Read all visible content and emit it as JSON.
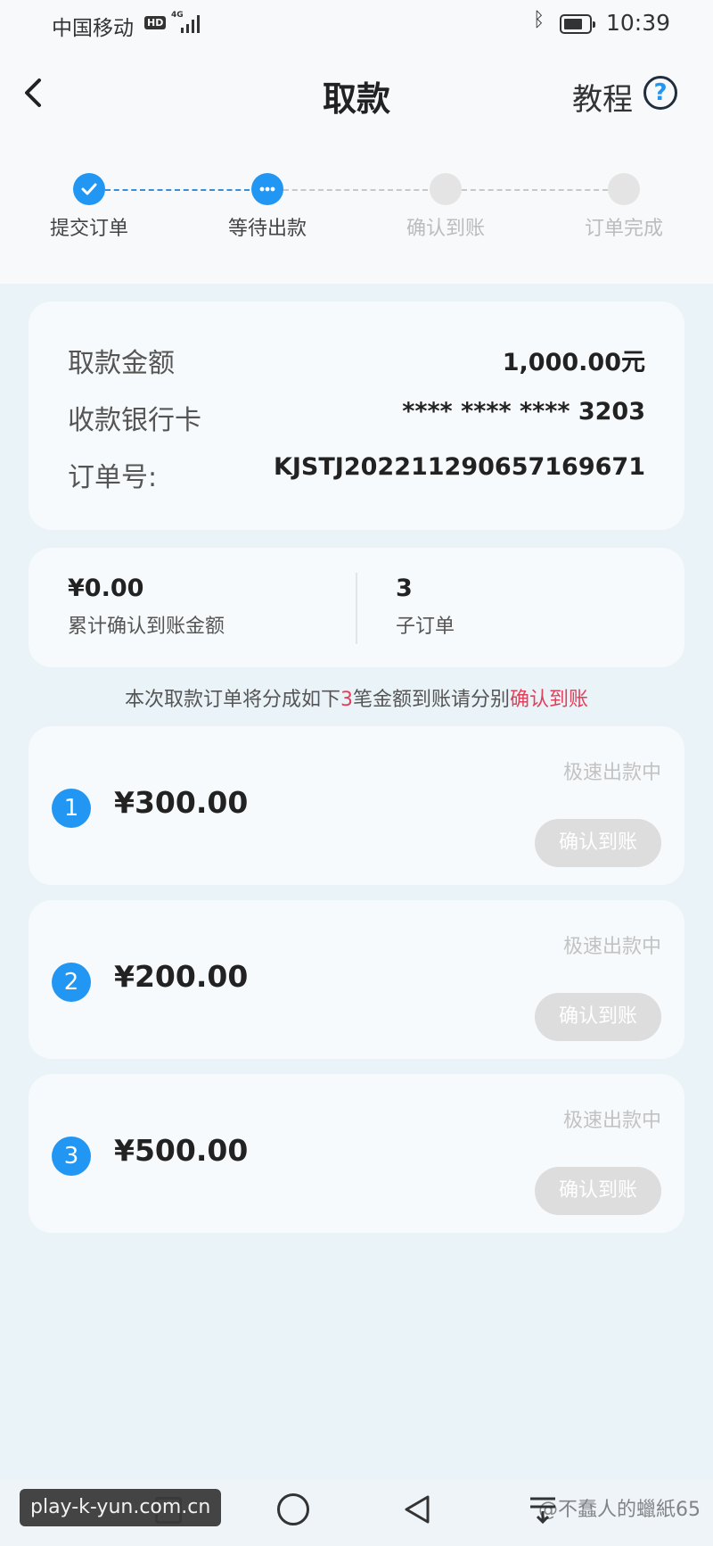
{
  "status_bar": {
    "carrier": "中国移动",
    "hd": "HD",
    "network": "4G",
    "time": "10:39"
  },
  "header": {
    "title": "取款",
    "tutorial_label": "教程",
    "help_icon": "?"
  },
  "stepper": {
    "steps": [
      {
        "label": "提交订单",
        "state": "done"
      },
      {
        "label": "等待出款",
        "state": "current"
      },
      {
        "label": "确认到账",
        "state": "pending"
      },
      {
        "label": "订单完成",
        "state": "pending"
      }
    ]
  },
  "info": {
    "amount_label": "取款金额",
    "amount_value": "1,000.00元",
    "card_label": "收款银行卡",
    "card_value": "**** **** **** 3203",
    "order_label": "订单号:",
    "order_value": "KJSTJ20221129065716967‌1"
  },
  "summary": {
    "confirmed_amount": "¥0.00",
    "confirmed_label": "累计确认到账金额",
    "sub_count": "3",
    "sub_label": "子订单"
  },
  "notice": {
    "part1": "本次取款订单将分成如下",
    "count": "3",
    "part2": "笔金额到账请分别",
    "action": "确认到账"
  },
  "orders": [
    {
      "index": "1",
      "amount": "¥300.00",
      "status": "极速出款中",
      "button": "确认到账"
    },
    {
      "index": "2",
      "amount": "¥200.00",
      "status": "极速出款中",
      "button": "确认到账"
    },
    {
      "index": "3",
      "amount": "¥500.00",
      "status": "极速出款中",
      "button": "确认到账"
    }
  ],
  "watermarks": {
    "left": "play-k-yun.com.cn",
    "right": "@不蠢人的蠟紙65"
  },
  "colors": {
    "accent": "#2196f3",
    "highlight": "#e0405a",
    "disabled_button": "#dddddd"
  }
}
